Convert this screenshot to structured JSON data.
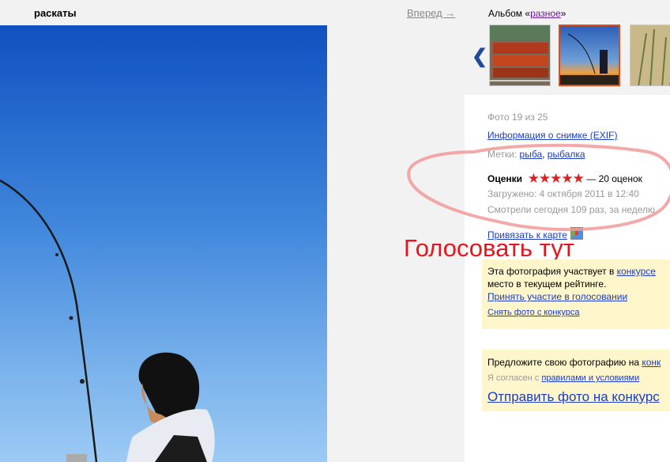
{
  "header": {
    "title": "раскаты",
    "forward_link": "Вперед →",
    "album_prefix": "Альбом «",
    "album_name": "разное",
    "album_suffix": "»"
  },
  "thumbnails": {
    "prev_arrow": "❮",
    "items": [
      "grill-thumbnail",
      "fishing-sunset-thumbnail",
      "grass-thumbnail"
    ]
  },
  "info": {
    "photo_counter": "Фото 19 из 25",
    "exif_link": "Информация о снимке (EXIF)",
    "tags_label": "Метки:",
    "tags": [
      "рыба",
      "рыбалка"
    ],
    "ratings_label": "Оценки",
    "stars": "★★★★★",
    "ratings_count": "— 20 оценок",
    "uploaded": "Загружено:  4 октября 2011 в 12:40",
    "views": "Смотрели сегодня 109 раз, за неделю",
    "map_link": "Привязать к карте"
  },
  "annotation": {
    "text": "Голосовать тут",
    "color": "#e8141b"
  },
  "contest": {
    "line1_text": "Эта фотография участвует в ",
    "line1_link": "конкурсе",
    "line2": "место в текущем рейтинге.",
    "vote_link": "Принять участие в голосовании",
    "remove_link": "Снять фото с конкурса"
  },
  "submit": {
    "line1_text": "Предложите свою фотографию на ",
    "line1_link": "конк",
    "agree_text": "Я согласен с ",
    "agree_link": "правилами и условиями",
    "send_link": "Отправить фото на конкурс"
  }
}
